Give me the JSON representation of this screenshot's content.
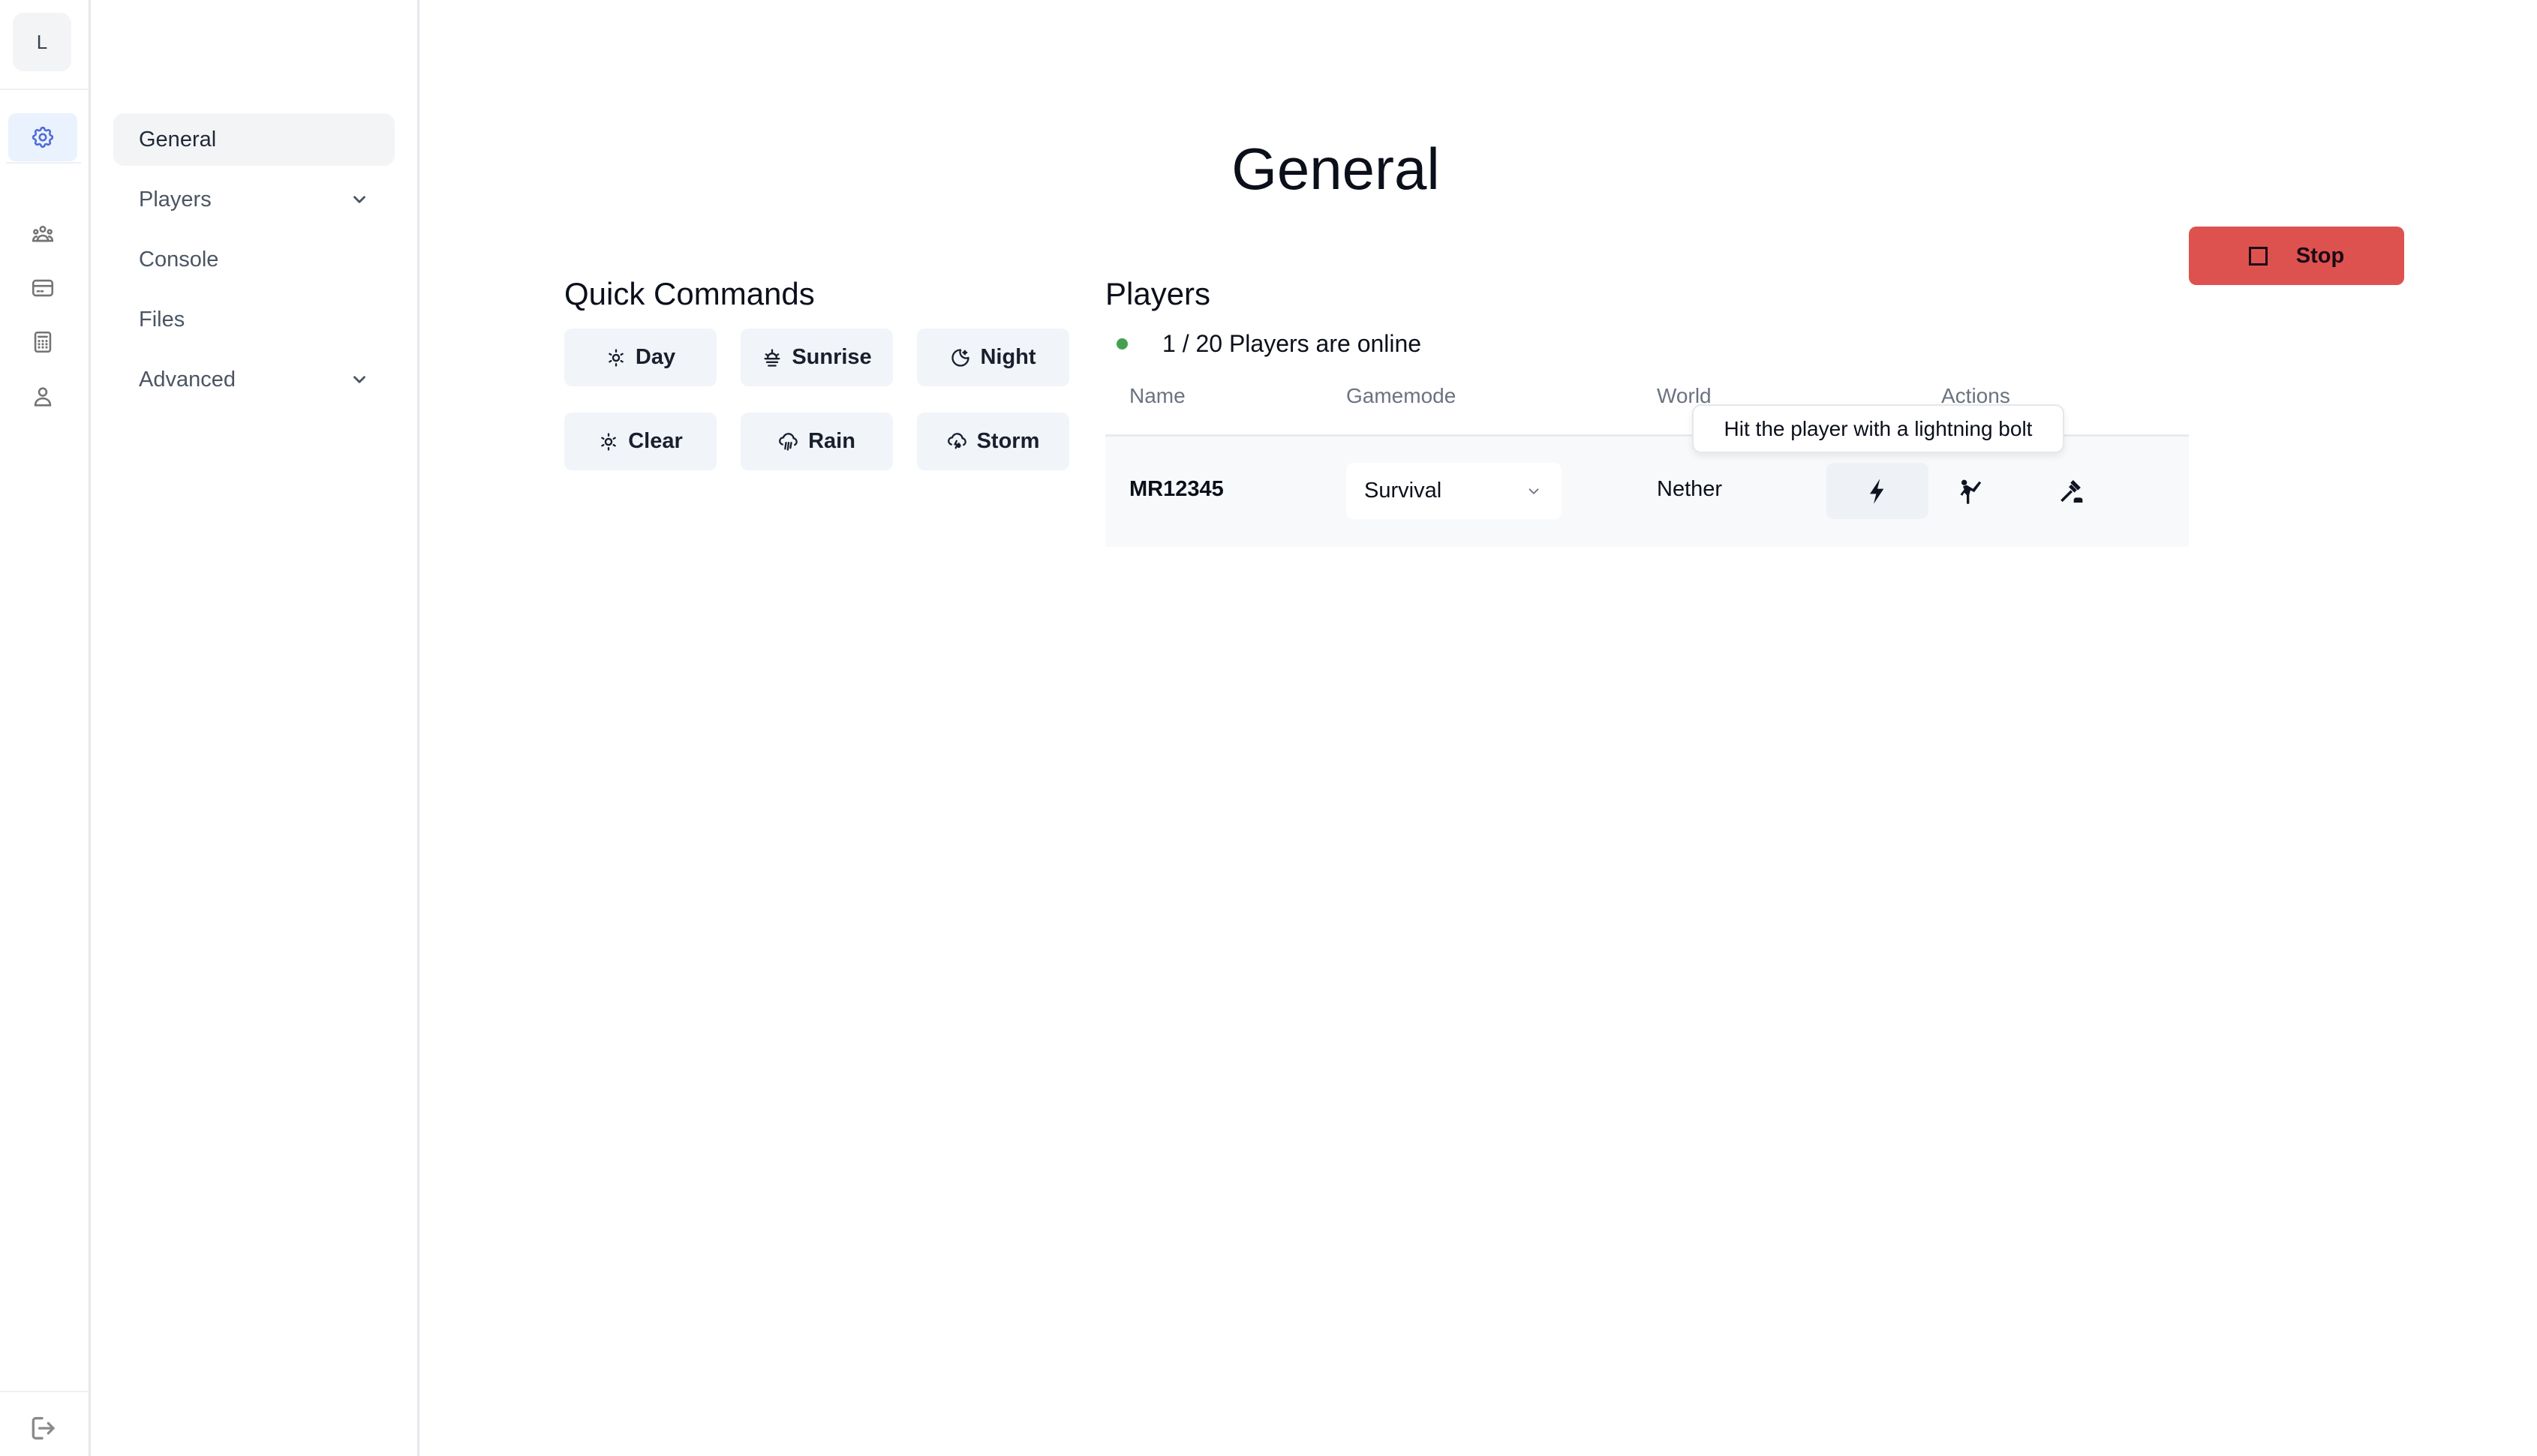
{
  "rail": {
    "avatar_initial": "L",
    "items": [
      {
        "name": "settings",
        "icon": "gear-icon",
        "active": true
      },
      {
        "name": "users",
        "icon": "users-group-icon",
        "active": false
      },
      {
        "name": "billing",
        "icon": "credit-card-icon",
        "active": false
      },
      {
        "name": "calculator",
        "icon": "calculator-icon",
        "active": false
      },
      {
        "name": "account",
        "icon": "user-icon",
        "active": false
      }
    ],
    "logout_icon": "logout-icon"
  },
  "nav": {
    "items": [
      {
        "label": "General",
        "active": true,
        "expandable": false
      },
      {
        "label": "Players",
        "active": false,
        "expandable": true
      },
      {
        "label": "Console",
        "active": false,
        "expandable": false
      },
      {
        "label": "Files",
        "active": false,
        "expandable": false
      },
      {
        "label": "Advanced",
        "active": false,
        "expandable": true
      }
    ]
  },
  "page": {
    "title": "General",
    "stop_label": "Stop"
  },
  "quick_commands": {
    "title": "Quick Commands",
    "buttons": [
      {
        "label": "Day",
        "icon": "sun-icon"
      },
      {
        "label": "Sunrise",
        "icon": "sunrise-icon"
      },
      {
        "label": "Night",
        "icon": "moon-star-icon"
      },
      {
        "label": "Clear",
        "icon": "sun-icon"
      },
      {
        "label": "Rain",
        "icon": "cloud-rain-icon"
      },
      {
        "label": "Storm",
        "icon": "cloud-storm-icon"
      }
    ]
  },
  "players": {
    "title": "Players",
    "online_text": "1 / 20 Players are online",
    "status_color": "#45a152",
    "columns": [
      "Name",
      "Gamemode",
      "World",
      "Actions"
    ],
    "rows": [
      {
        "name": "MR12345",
        "gamemode": "Survival",
        "world": "Nether",
        "actions": [
          {
            "icon": "lightning-icon",
            "tooltip": "Hit the player with a lightning bolt"
          },
          {
            "icon": "kick-icon"
          },
          {
            "icon": "ban-hammer-icon"
          }
        ]
      }
    ],
    "tooltip_text": "Hit the player with a lightning bolt"
  },
  "colors": {
    "accent": "#4f6bd8",
    "stop": "#dd524f"
  }
}
